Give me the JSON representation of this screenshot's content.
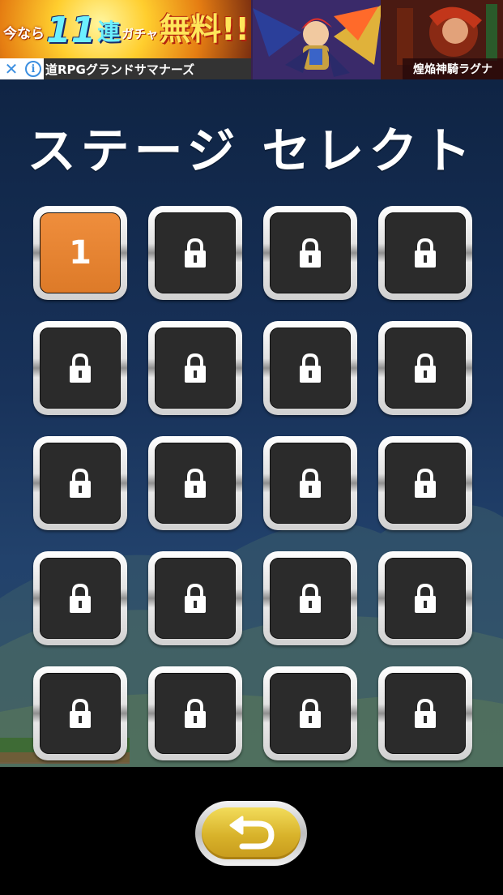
{
  "ad": {
    "headline_prefix": "今なら",
    "headline_number": "11",
    "headline_ren": "連",
    "headline_gacha": "ガチャ",
    "headline_free": "無料!!",
    "close_symbol": "✕",
    "info_symbol": "i",
    "sponsor": "道RPGグランドサマナーズ",
    "sub_title": "煌焔神騎ラグナ"
  },
  "screen": {
    "title": "ステージ セレクト"
  },
  "stages": [
    {
      "label": "1",
      "locked": false
    },
    {
      "label": "",
      "locked": true
    },
    {
      "label": "",
      "locked": true
    },
    {
      "label": "",
      "locked": true
    },
    {
      "label": "",
      "locked": true
    },
    {
      "label": "",
      "locked": true
    },
    {
      "label": "",
      "locked": true
    },
    {
      "label": "",
      "locked": true
    },
    {
      "label": "",
      "locked": true
    },
    {
      "label": "",
      "locked": true
    },
    {
      "label": "",
      "locked": true
    },
    {
      "label": "",
      "locked": true
    },
    {
      "label": "",
      "locked": true
    },
    {
      "label": "",
      "locked": true
    },
    {
      "label": "",
      "locked": true
    },
    {
      "label": "",
      "locked": true
    },
    {
      "label": "",
      "locked": true
    },
    {
      "label": "",
      "locked": true
    },
    {
      "label": "",
      "locked": true
    },
    {
      "label": "",
      "locked": true
    }
  ],
  "icons": {
    "locked_stage": "lock-icon",
    "back": "return-arrow-icon",
    "ad_close": "close-icon",
    "ad_info": "info-icon"
  },
  "colors": {
    "unlocked_tile": "#dd7a28",
    "locked_tile": "#2b2b2b",
    "back_button": "#d8b22a",
    "background": "#18325a"
  }
}
